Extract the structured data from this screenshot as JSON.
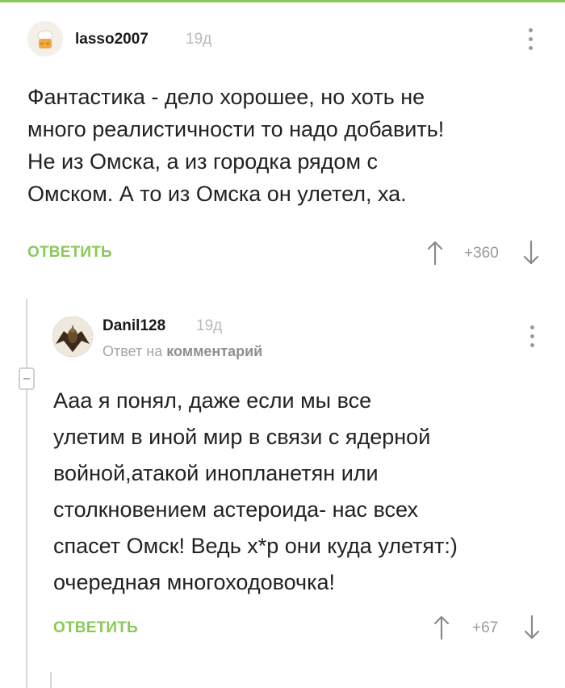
{
  "comments": [
    {
      "username": "lasso2007",
      "time": "19д",
      "body_lines": [
        "Фантастика - дело хорошее, но хоть не",
        "много реалистичности то надо добавить!",
        "Не из Омска, а из городка рядом с",
        "Омском. А то из Омска он улетел, ха."
      ],
      "reply_label": "ОТВЕТИТЬ",
      "rating": "+360"
    },
    {
      "username": "Danil128",
      "time": "19д",
      "reply_to_prefix": "Ответ на",
      "reply_to_target": "комментарий",
      "body_lines": [
        "Ааа я понял, даже если мы все",
        "улетим в иной мир в связи с ядерной",
        "войной,атакой инопланетян или",
        "столкновением астероида- нас всех",
        "спасет Омск! Ведь х*р они куда улетят:)",
        "очередная многоходовочка!"
      ],
      "reply_label": "ОТВЕТИТЬ",
      "rating": "+67"
    }
  ],
  "icons": {
    "more": "more-vertical-icon",
    "upvote": "arrow-up-icon",
    "downvote": "arrow-down-icon",
    "collapse": "collapse-minus-icon"
  },
  "colors": {
    "accent": "#8ac858",
    "muted": "#9a9a9a",
    "text": "#222222"
  }
}
